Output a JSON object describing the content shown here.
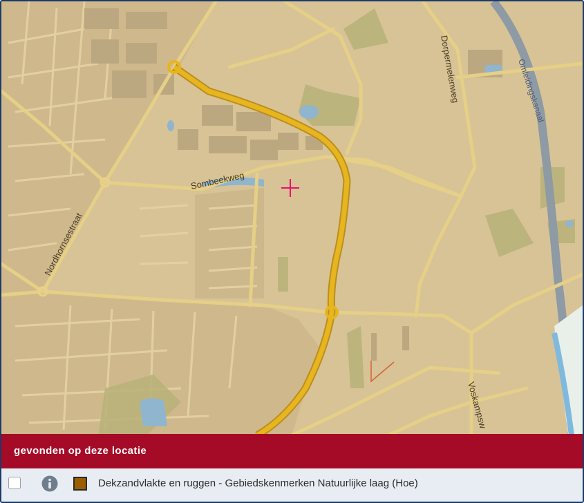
{
  "map": {
    "streets": {
      "sombeekweg": "Sombeekweg",
      "nordhornsestraat": "Nordhornsestraat",
      "dorpermelenweg": "Dorpermelenweg",
      "voskampsweg": "Voskampsw",
      "omleidingskanaal": "Omleidingskanaal"
    },
    "marker": "crosshair-marker"
  },
  "results": {
    "title": "gevonden op deze locatie",
    "items": [
      {
        "label": "Dekzandvlakte en ruggen - Gebiedskenmerken Natuurlijke laag (Hoe)",
        "swatch_color": "#9a5e00",
        "checked": false,
        "info_icon": "info-icon"
      }
    ]
  },
  "colors": {
    "map_background": "#d8c397",
    "urban": "#cdb78a",
    "buildings": "#b9a57c",
    "highway": "#e6b21e",
    "water": "#8ab8d6",
    "banner": "#a50a27",
    "marker": "#e8116a"
  }
}
